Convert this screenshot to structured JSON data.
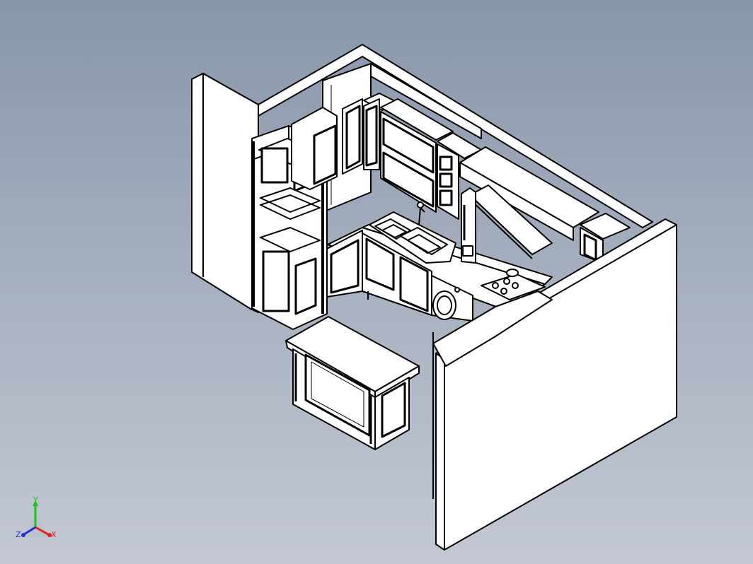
{
  "viewport": {
    "background_top": "#8796aa",
    "background_bottom": "#c3c8d3",
    "line_color": "#000000",
    "face_color": "#ffffff"
  },
  "model": {
    "description_name": "kitchen-cabinet-assembly"
  },
  "triad": {
    "x_label": "X",
    "y_label": "Y",
    "z_label": "Z",
    "x_color": "#e02020",
    "y_color": "#20c020",
    "z_color": "#2030d0"
  }
}
